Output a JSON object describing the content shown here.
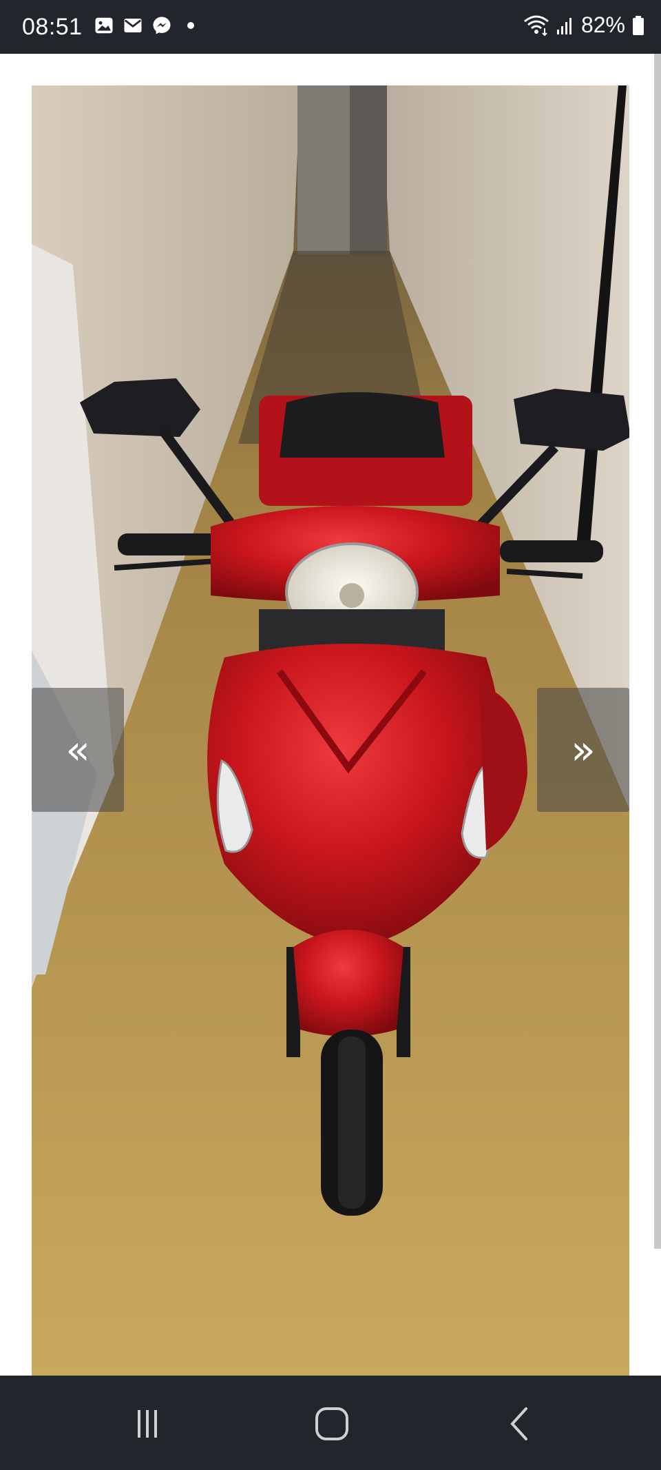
{
  "status_bar": {
    "time": "08:51",
    "left_icons": [
      "gallery-icon",
      "mail-icon",
      "messenger-icon",
      "notification-dot"
    ],
    "right_icons": [
      "wifi-icon",
      "signal-icon",
      "battery-icon"
    ],
    "battery": "82%"
  },
  "gallery": {
    "image": "red-three-wheel-scooter-photo",
    "prev_label": "«",
    "next_label": "»"
  },
  "nav_bar": {
    "buttons": [
      "recent-apps-icon",
      "home-icon",
      "back-icon"
    ]
  },
  "colors": {
    "bar_background": "#22252b",
    "scooter_red": "#c0141c",
    "floor": "#bf9d4f",
    "wall": "#d2c7b8"
  }
}
